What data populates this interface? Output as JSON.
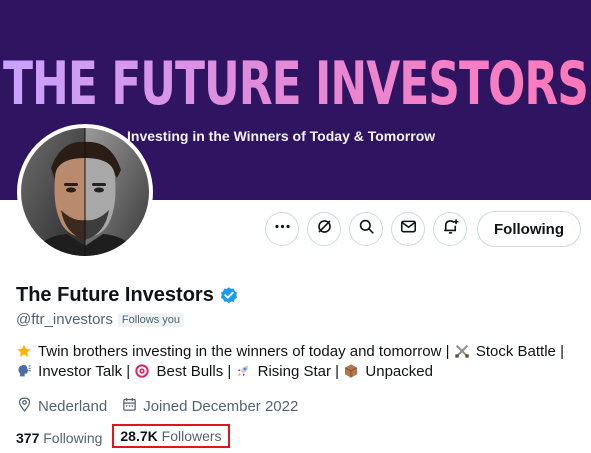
{
  "banner": {
    "title": "THE FUTURE INVESTORS",
    "tagline": "Investing in the Winners of Today & Tomorrow",
    "background_color": "#2f1561"
  },
  "profile": {
    "display_name": "The Future Investors",
    "handle": "@ftr_investors",
    "follows_you_badge": "Follows you",
    "verified": true,
    "bio_parts": {
      "p1": "Twin brothers investing in the winners of today and tomorrow |",
      "p2": "Stock Battle",
      "p3": "|",
      "p4": "Investor Talk |",
      "p5": "Best Bulls |",
      "p6": "Rising Star |",
      "p7": "Unpacked"
    },
    "location": "Nederland",
    "joined": "Joined December 2022"
  },
  "actions": {
    "more_icon": "more-icon",
    "grok_icon": "grok-icon",
    "search_icon": "search-icon",
    "message_icon": "message-icon",
    "notify_icon": "notify-icon",
    "follow_label": "Following"
  },
  "stats": {
    "following_count": "377",
    "following_label": "Following",
    "followers_count": "28.7K",
    "followers_label": "Followers",
    "highlight_color": "#e0161b"
  }
}
